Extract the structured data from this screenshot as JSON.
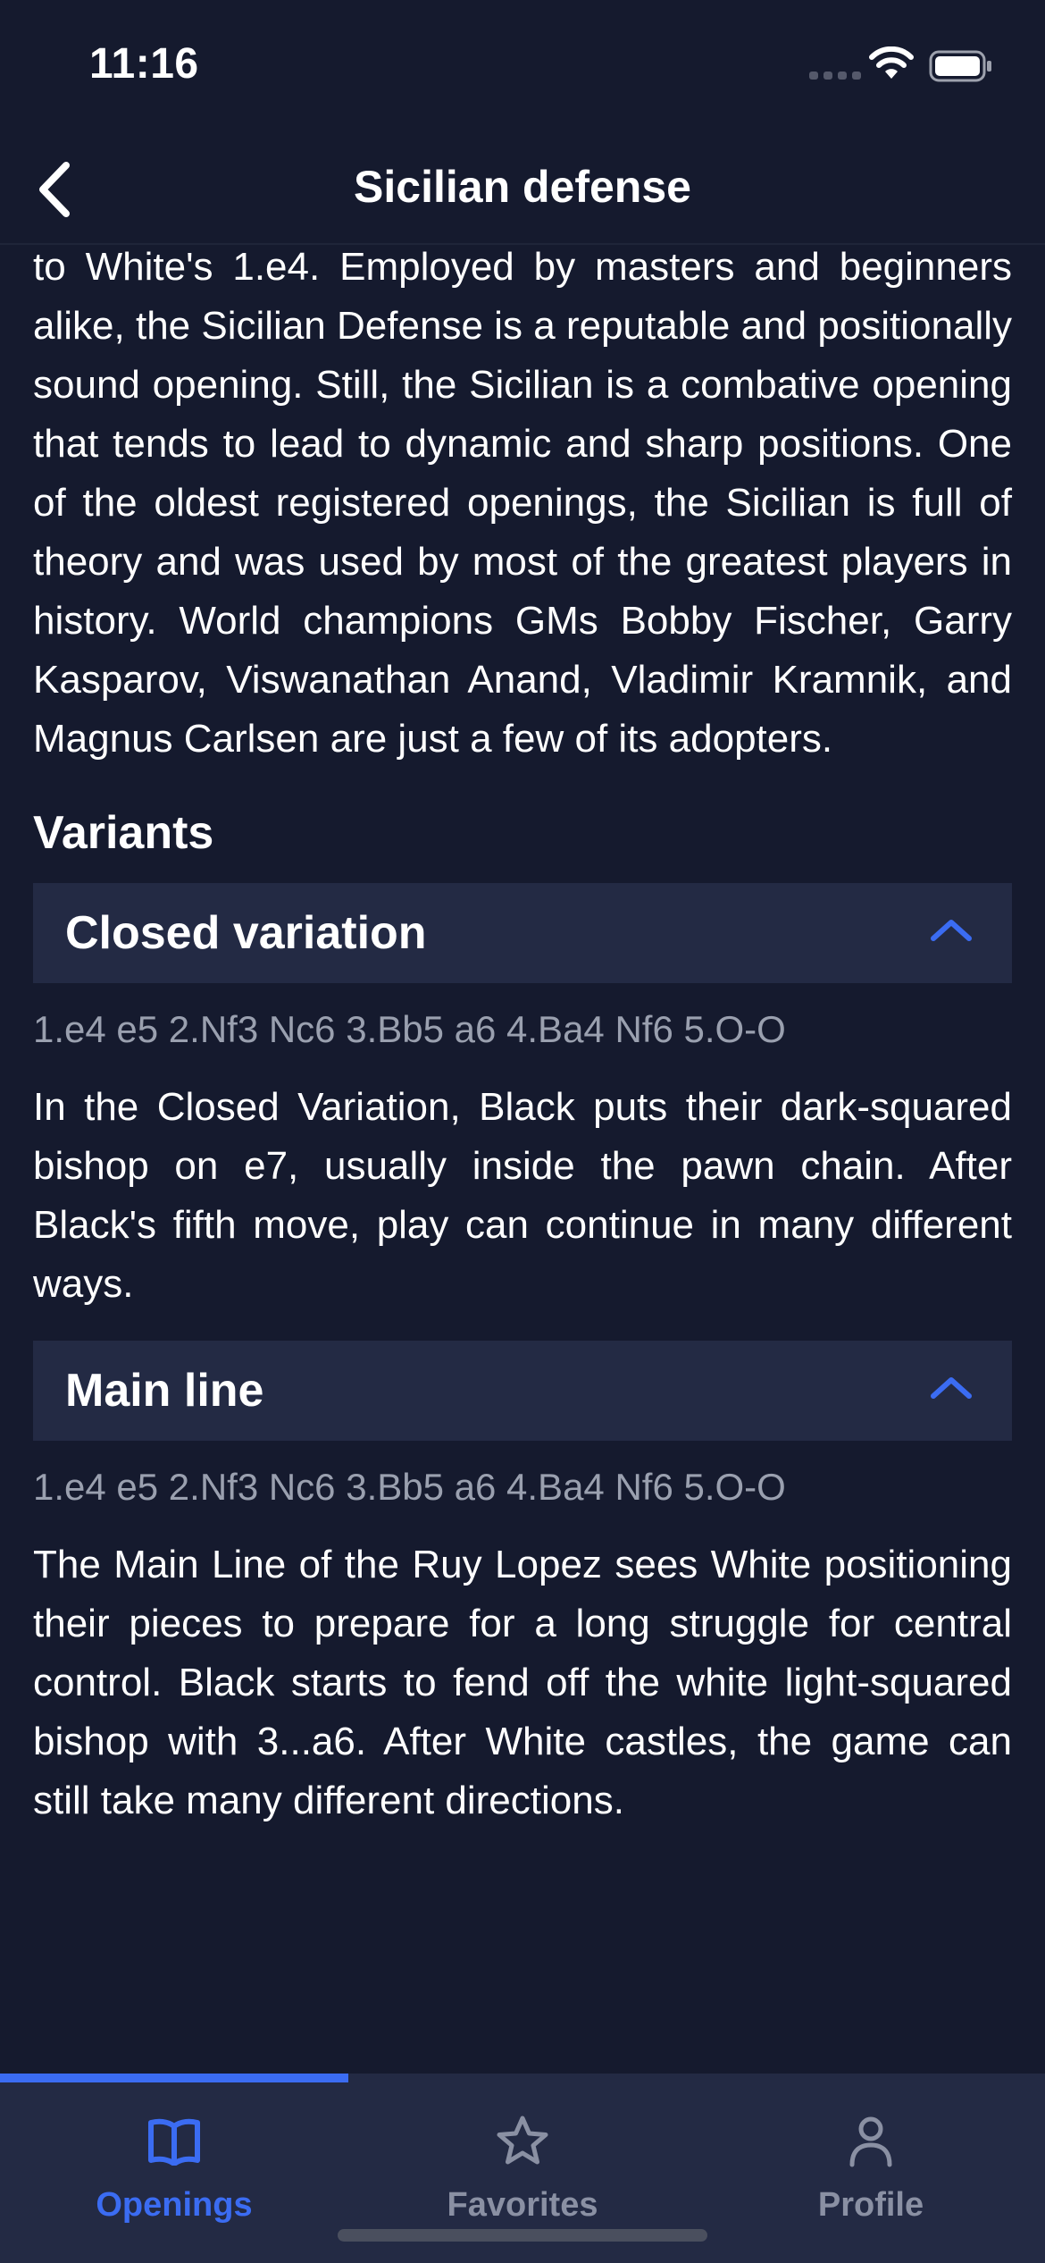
{
  "status_bar": {
    "time": "11:16"
  },
  "nav": {
    "title": "Sicilian defense"
  },
  "content": {
    "intro_lines": [
      "to White's 1.e4. Employed by masters and",
      "beginners alike, the Sicilian Defense is a reputable",
      "and positionally sound opening. Still, the Sicilian is",
      "a combative opening that tends to lead to",
      "dynamic and sharp positions.  One of the oldest",
      "registered openings, the Sicilian is full of theory",
      "and was used by most of the greatest players in",
      "history. World champions GMs Bobby Fischer,",
      "Garry Kasparov, Viswanathan Anand, Vladimir",
      "Kramnik, and Magnus Carlsen are just a few of its",
      "adopters."
    ],
    "variants_heading": "Variants",
    "variants": [
      {
        "title": "Closed variation",
        "moves": "1.e4 e5 2.Nf3 Nc6 3.Bb5 a6 4.Ba4 Nf6 5.O-O",
        "description": "In the Closed Variation, Black puts their dark-squared bishop on e7, usually inside the pawn chain. After Black's fifth move, play can continue in many different ways."
      },
      {
        "title": "Main line",
        "moves": "1.e4 e5 2.Nf3 Nc6 3.Bb5 a6 4.Ba4 Nf6 5.O-O",
        "description": "The Main Line of the Ruy Lopez sees White positioning their pieces to prepare for a long struggle for central control. Black starts to fend off the white light-squared bishop with 3...a6. After White castles, the game can still take many different directions."
      }
    ]
  },
  "tabs": [
    {
      "label": "Openings",
      "icon": "book-icon",
      "active": true
    },
    {
      "label": "Favorites",
      "icon": "star-icon",
      "active": false
    },
    {
      "label": "Profile",
      "icon": "person-icon",
      "active": false
    }
  ],
  "colors": {
    "background": "#151a2e",
    "card": "#232a44",
    "accent": "#3b6cf2",
    "muted": "#9aa0af",
    "inactive": "#8a90a3"
  }
}
